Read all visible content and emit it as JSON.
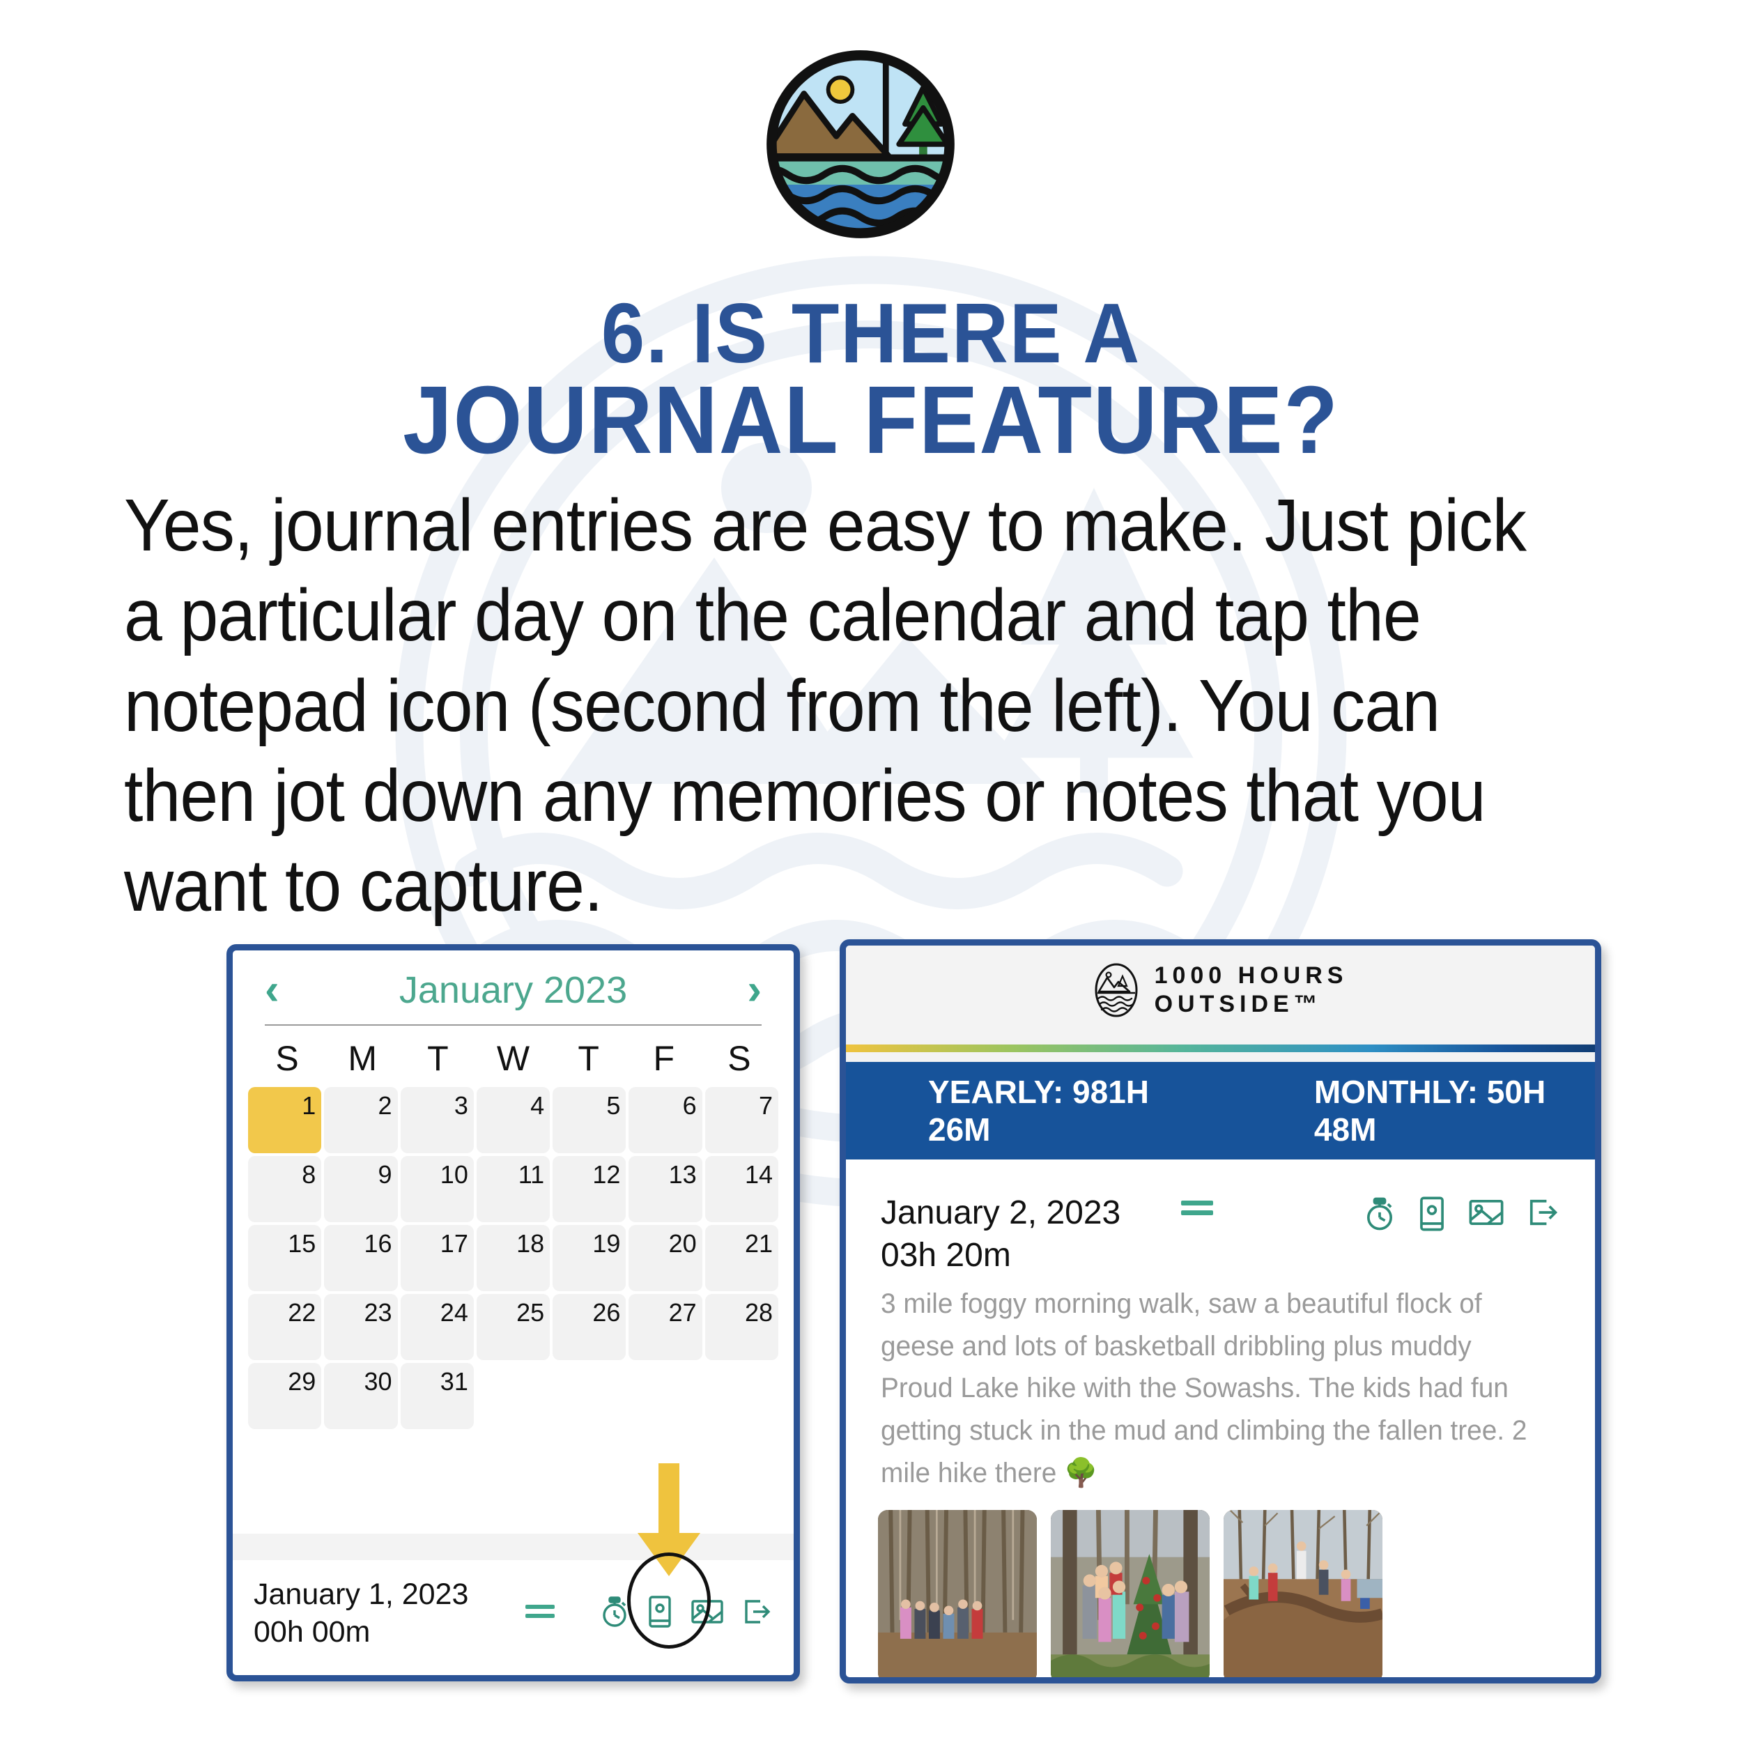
{
  "brand": {
    "name": "1000 HOURS OUTSIDE",
    "line1": "1000 HOURS",
    "line2": "OUTSIDE™",
    "logo_icon": "mountain-lake-circle-logo",
    "title_color": "#2B5396",
    "accent_teal": "#3FA68C",
    "accent_gold": "#F2C84B",
    "stats_blue": "#17539A"
  },
  "title": {
    "line1": "6. IS THERE A",
    "line2": "JOURNAL FEATURE?"
  },
  "body": {
    "text": "Yes, journal entries are easy to make. Just pick a particular day on the calendar and tap the notepad icon (second from the left). You can then jot down any memories or notes that you want to capture."
  },
  "calendar": {
    "prev_label": "‹",
    "next_label": "›",
    "month": "January 2023",
    "dow": [
      "S",
      "M",
      "T",
      "W",
      "T",
      "F",
      "S"
    ],
    "weeks": [
      [
        "1",
        "2",
        "3",
        "4",
        "5",
        "6",
        "7"
      ],
      [
        "8",
        "9",
        "10",
        "11",
        "12",
        "13",
        "14"
      ],
      [
        "15",
        "16",
        "17",
        "18",
        "19",
        "20",
        "21"
      ],
      [
        "22",
        "23",
        "24",
        "25",
        "26",
        "27",
        "28"
      ],
      [
        "29",
        "30",
        "31",
        "",
        "",
        "",
        ""
      ]
    ],
    "selected_day": "1",
    "footer": {
      "date": "January 1, 2023",
      "duration": "00h 00m",
      "menu_icon": "equals-menu-icon",
      "icons": [
        "stopwatch-icon",
        "notepad-icon",
        "photo-icon",
        "export-icon"
      ]
    },
    "annotation": {
      "arrow_icon": "down-arrow-annotation",
      "circle_icon": "oval-highlight-annotation",
      "points_to": "notepad-icon"
    }
  },
  "tracker": {
    "stats": {
      "yearly_label": "YEARLY: 981H 26M",
      "monthly_label": "MONTHLY: 50H 48M"
    },
    "entry": {
      "date": "January 2, 2023",
      "duration": "03h 20m",
      "menu_icon": "equals-menu-icon",
      "icons": [
        "stopwatch-icon",
        "notepad-icon",
        "photo-icon",
        "export-icon"
      ],
      "note": "3 mile foggy morning walk, saw a beautiful flock of geese and lots of basketball dribbling plus muddy Proud Lake hike with the Sowashs. The kids had fun getting stuck in the mud and climbing the fallen tree. 2 mile hike there 🌳",
      "photos": [
        "forest-tall-pines-group-photo",
        "kids-by-decorated-tree-photo",
        "kids-climbing-fallen-tree-photo"
      ]
    }
  }
}
